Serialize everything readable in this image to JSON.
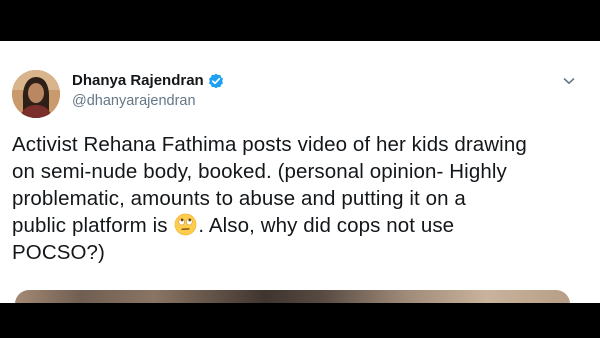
{
  "tweet": {
    "display_name": "Dhanya Rajendran",
    "handle": "@dhanyarajendran",
    "verified": true,
    "text_lines": [
      "Activist Rehana Fathima posts video of her kids drawing",
      "on semi-nude body, booked. (personal opinion- Highly",
      "problematic, amounts to abuse and putting it on a"
    ],
    "line4_before_emoji": "public platform is ",
    "line4_emoji": "face-with-rolling-eyes-emoji",
    "line4_after_emoji": ". Also, why did cops not use",
    "line5": "POCSO?)",
    "icons": {
      "verified": "verified-badge-icon",
      "menu": "chevron-down-icon"
    }
  },
  "colors": {
    "text_primary": "#14171a",
    "text_secondary": "#657786",
    "verified_blue": "#1da1f2",
    "background": "#ffffff",
    "letterbox": "#000000"
  }
}
